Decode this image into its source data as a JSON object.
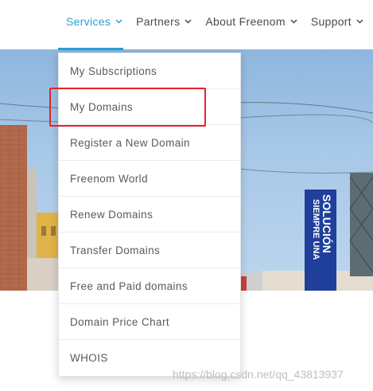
{
  "nav": {
    "items": [
      {
        "label": "Services",
        "active": true
      },
      {
        "label": "Partners",
        "active": false
      },
      {
        "label": "About Freenom",
        "active": false
      },
      {
        "label": "Support",
        "active": false
      }
    ],
    "accent_color": "#2a9fd6"
  },
  "dropdown": {
    "items": [
      "My Subscriptions",
      "My Domains",
      "Register a New Domain",
      "Freenom World",
      "Renew Domains",
      "Transfer Domains",
      "Free and Paid domains",
      "Domain Price Chart",
      "WHOIS"
    ],
    "highlighted_item": "My Domains",
    "highlight_color": "#e8202a"
  },
  "hero": {
    "billboard_text": [
      "SOLUCIÓN",
      "SIEMPRE UNA"
    ]
  },
  "watermark": "https://blog.csdn.net/qq_43813937"
}
